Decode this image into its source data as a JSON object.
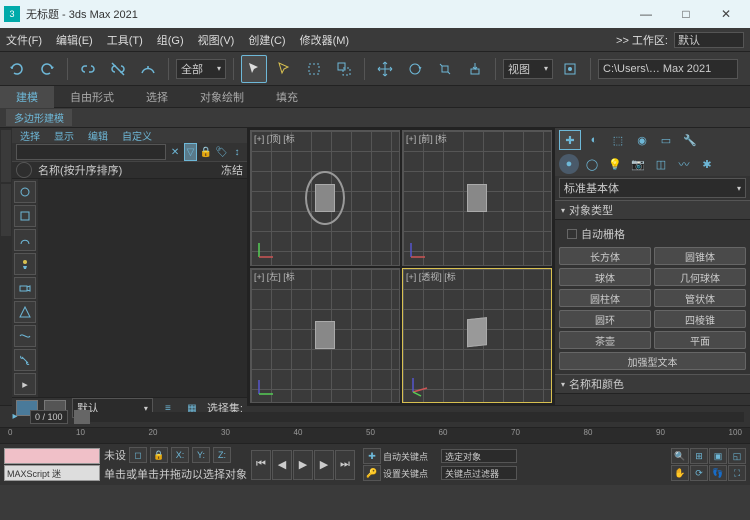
{
  "title": "无标题 - 3ds Max 2021",
  "app_icon": "3",
  "menus": [
    "文件(F)",
    "编辑(E)",
    "工具(T)",
    "组(G)",
    "视图(V)",
    "创建(C)",
    "修改器(M)"
  ],
  "workzone": {
    "label": ">> 工作区:",
    "value": "默认"
  },
  "toolbar": {
    "scope": "全部",
    "view": "视图",
    "path": "C:\\Users\\… Max 2021"
  },
  "ribbon_tabs": [
    "建模",
    "自由形式",
    "选择",
    "对象绘制",
    "填充"
  ],
  "sub_ribbon": "多边形建模",
  "scene": {
    "tabs": [
      "选择",
      "显示",
      "编辑",
      "自定义"
    ],
    "col_name": "名称(按升序排序)",
    "col_freeze": "冻结",
    "footer_layer": "默认",
    "selset_label": "选择集:"
  },
  "viewports": {
    "tl": "[+] [顶] [标",
    "tr": "[+] [前] [标",
    "bl": "[+] [左] [标",
    "br": "[+] [透视] [标"
  },
  "cmd": {
    "category": "标准基本体",
    "rollout1": "对象类型",
    "autogrid": "自动栅格",
    "buttons": [
      [
        "长方体",
        "圆锥体"
      ],
      [
        "球体",
        "几何球体"
      ],
      [
        "圆柱体",
        "管状体"
      ],
      [
        "圆环",
        "四棱锥"
      ],
      [
        "茶壶",
        "平面"
      ]
    ],
    "btn_bottom": "加强型文本",
    "rollout2": "名称和颜色"
  },
  "timeslider": "0 / 100",
  "timeline_ticks": [
    "0",
    "10",
    "20",
    "30",
    "40",
    "50",
    "60",
    "70",
    "80",
    "90",
    "100"
  ],
  "status": {
    "tag": "未设",
    "maxscript": "MAXScript 迷",
    "prompt": "单击或单击并拖动以选择对象",
    "autokey": "自动关键点",
    "selobj": "选定对象",
    "setkey": "设置关键点",
    "keyfilter": "关键点过滤器"
  }
}
